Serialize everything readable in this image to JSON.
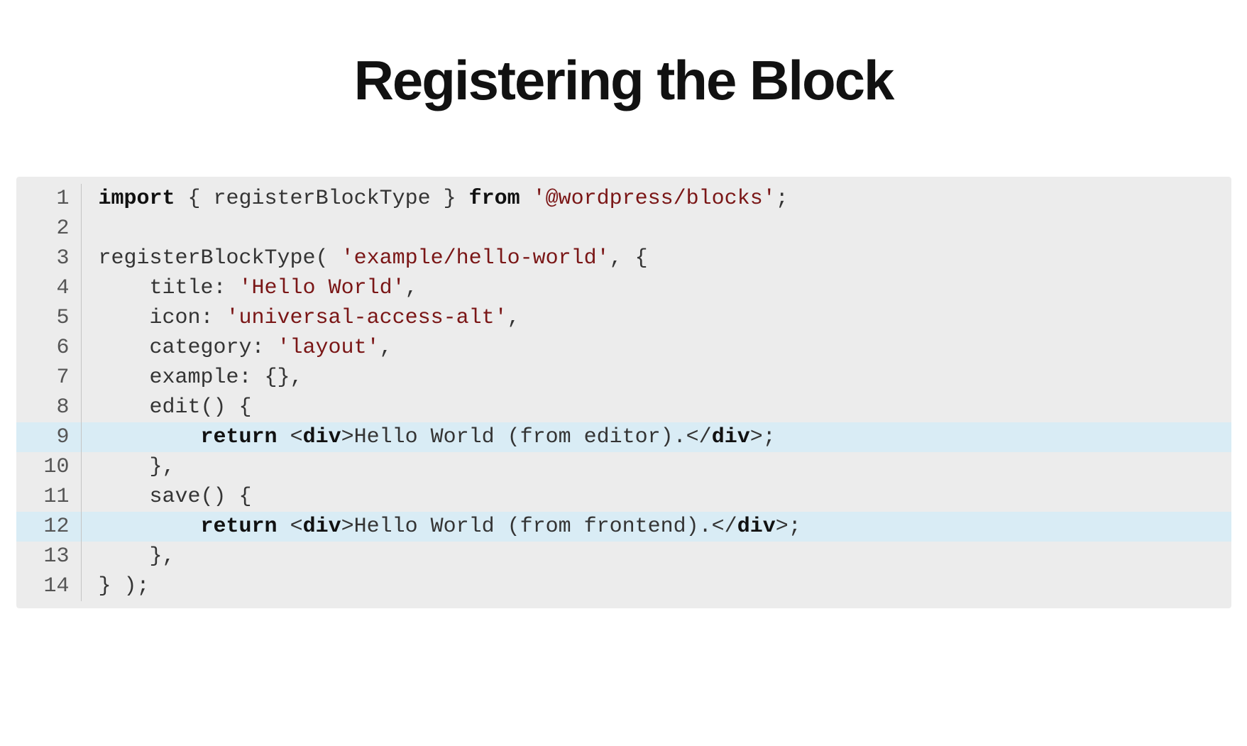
{
  "title": "Registering the Block",
  "code": {
    "highlight_lines": [
      9,
      12
    ],
    "lines": [
      {
        "n": 1,
        "tokens": [
          {
            "t": "kw",
            "v": "import"
          },
          {
            "t": "txt",
            "v": " { registerBlockType } "
          },
          {
            "t": "kw",
            "v": "from"
          },
          {
            "t": "txt",
            "v": " "
          },
          {
            "t": "str",
            "v": "'@wordpress/blocks'"
          },
          {
            "t": "txt",
            "v": ";"
          }
        ]
      },
      {
        "n": 2,
        "tokens": [
          {
            "t": "txt",
            "v": ""
          }
        ]
      },
      {
        "n": 3,
        "tokens": [
          {
            "t": "txt",
            "v": "registerBlockType( "
          },
          {
            "t": "str",
            "v": "'example/hello-world'"
          },
          {
            "t": "txt",
            "v": ", {"
          }
        ]
      },
      {
        "n": 4,
        "tokens": [
          {
            "t": "txt",
            "v": "    title: "
          },
          {
            "t": "str",
            "v": "'Hello World'"
          },
          {
            "t": "txt",
            "v": ","
          }
        ]
      },
      {
        "n": 5,
        "tokens": [
          {
            "t": "txt",
            "v": "    icon: "
          },
          {
            "t": "str",
            "v": "'universal-access-alt'"
          },
          {
            "t": "txt",
            "v": ","
          }
        ]
      },
      {
        "n": 6,
        "tokens": [
          {
            "t": "txt",
            "v": "    category: "
          },
          {
            "t": "str",
            "v": "'layout'"
          },
          {
            "t": "txt",
            "v": ","
          }
        ]
      },
      {
        "n": 7,
        "tokens": [
          {
            "t": "txt",
            "v": "    example: {},"
          }
        ]
      },
      {
        "n": 8,
        "tokens": [
          {
            "t": "txt",
            "v": "    edit() {"
          }
        ]
      },
      {
        "n": 9,
        "tokens": [
          {
            "t": "txt",
            "v": "        "
          },
          {
            "t": "kw",
            "v": "return"
          },
          {
            "t": "txt",
            "v": " <"
          },
          {
            "t": "tag",
            "v": "div"
          },
          {
            "t": "txt",
            "v": ">Hello World (from editor).</"
          },
          {
            "t": "tag",
            "v": "div"
          },
          {
            "t": "txt",
            "v": ">;"
          }
        ]
      },
      {
        "n": 10,
        "tokens": [
          {
            "t": "txt",
            "v": "    },"
          }
        ]
      },
      {
        "n": 11,
        "tokens": [
          {
            "t": "txt",
            "v": "    save() {"
          }
        ]
      },
      {
        "n": 12,
        "tokens": [
          {
            "t": "txt",
            "v": "        "
          },
          {
            "t": "kw",
            "v": "return"
          },
          {
            "t": "txt",
            "v": " <"
          },
          {
            "t": "tag",
            "v": "div"
          },
          {
            "t": "txt",
            "v": ">Hello World (from frontend).</"
          },
          {
            "t": "tag",
            "v": "div"
          },
          {
            "t": "txt",
            "v": ">;"
          }
        ]
      },
      {
        "n": 13,
        "tokens": [
          {
            "t": "txt",
            "v": "    },"
          }
        ]
      },
      {
        "n": 14,
        "tokens": [
          {
            "t": "txt",
            "v": "} );"
          }
        ]
      }
    ]
  }
}
